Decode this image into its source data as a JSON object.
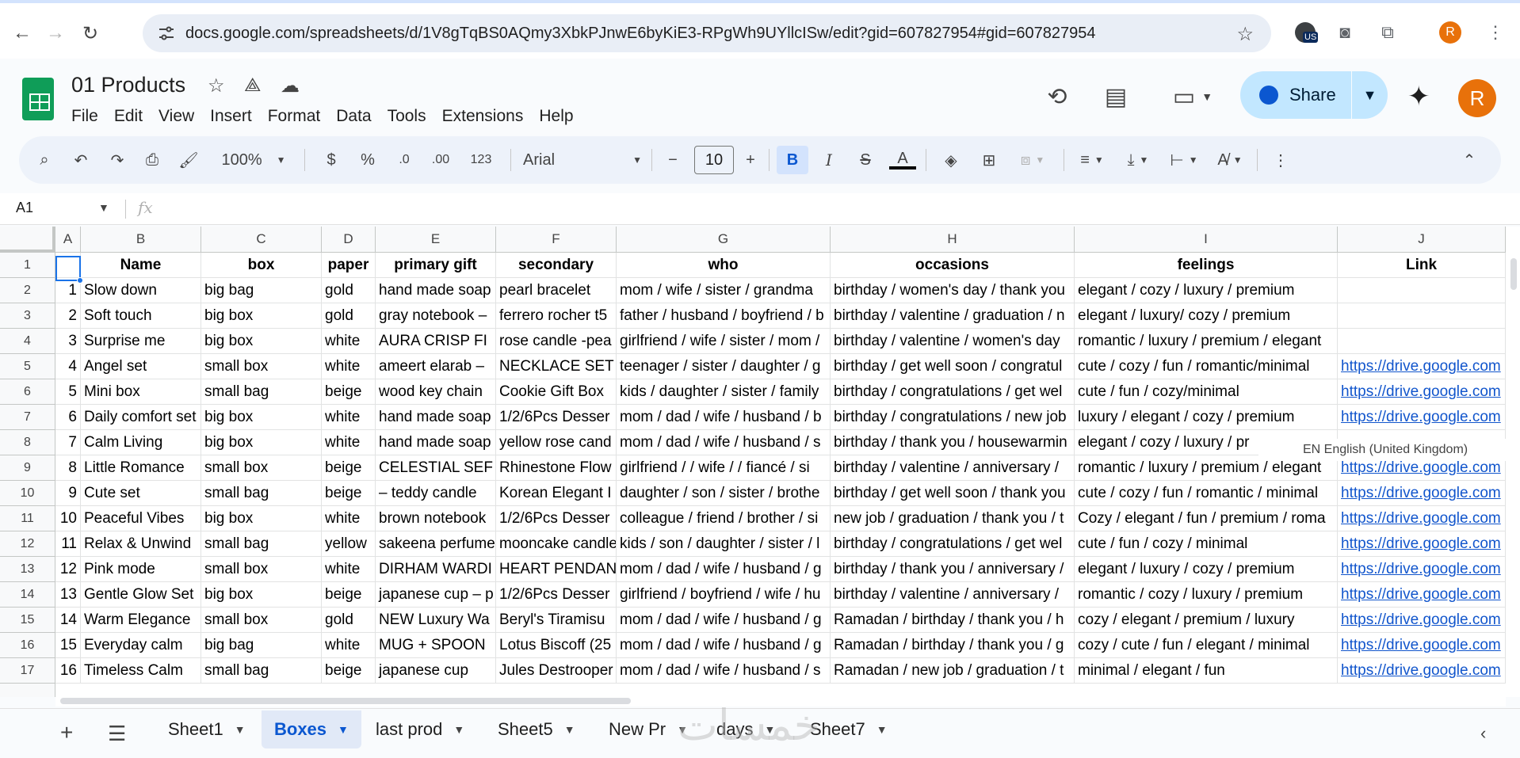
{
  "browser": {
    "url": "docs.google.com/spreadsheets/d/1V8gTqBS0AQmy3XbkPJnwE6byKiE3-RPgWh9UYllcISw/edit?gid=607827954#gid=607827954",
    "ext_badge": "US",
    "profile_initial": "R"
  },
  "doc": {
    "title": "01 Products",
    "menu": [
      "File",
      "Edit",
      "View",
      "Insert",
      "Format",
      "Data",
      "Tools",
      "Extensions",
      "Help"
    ],
    "share_label": "Share",
    "avatar_initial": "R"
  },
  "toolbar": {
    "zoom": "100%",
    "currency": "$",
    "percent": "%",
    "dec_decrease": ".0",
    "dec_increase": ".00",
    "number_format": "123",
    "font": "Arial",
    "font_size": "10",
    "minus": "−",
    "plus": "+",
    "bold": "B",
    "italic": "I",
    "strike": "S",
    "text_color": "A"
  },
  "formula": {
    "cell_ref": "A1",
    "fx": "fx"
  },
  "grid": {
    "columns": [
      "A",
      "B",
      "C",
      "D",
      "E",
      "F",
      "G",
      "H",
      "I",
      "J"
    ],
    "header_row": [
      "",
      "Name",
      "box",
      "paper",
      "primary gift",
      "secondary",
      "who",
      "occasions",
      "feelings",
      "Link"
    ],
    "rows": [
      {
        "n": "2",
        "cells": [
          "1",
          "Slow down",
          "big bag",
          "gold",
          "hand made soap",
          "pearl bracelet",
          "mom / wife / sister / grandma",
          "birthday / women's day / thank you",
          "elegant / cozy / luxury / premium",
          ""
        ]
      },
      {
        "n": "3",
        "cells": [
          "2",
          "Soft touch",
          "big box",
          "gold",
          "gray notebook –",
          "ferrero rocher t5",
          "father / husband / boyfriend / b",
          "birthday / valentine / graduation / n",
          "elegant / luxury/ cozy / premium",
          ""
        ]
      },
      {
        "n": "4",
        "cells": [
          "3",
          "Surprise me",
          "big box",
          "white",
          " AURA CRISP FI",
          "rose candle -pea",
          "girlfriend / wife / sister / mom /",
          "birthday / valentine / women's day",
          "romantic / luxury / premium / elegant",
          ""
        ]
      },
      {
        "n": "5",
        "cells": [
          "4",
          "Angel set",
          "small box",
          "white",
          "ameert elarab –",
          "NECKLACE SET",
          "teenager / sister / daughter / g",
          "birthday / get well soon / congratul",
          "cute / cozy / fun / romantic/minimal",
          "https://drive.google.com"
        ]
      },
      {
        "n": "6",
        "cells": [
          "5",
          "Mini box",
          "small bag",
          "beige",
          "wood key chain",
          " Cookie Gift Box",
          "kids / daughter / sister / family",
          "birthday / congratulations / get wel",
          "cute / fun / cozy/minimal",
          "https://drive.google.com"
        ]
      },
      {
        "n": "7",
        "cells": [
          "6",
          "Daily comfort set",
          "big box",
          "white",
          "hand made soap",
          "1/2/6Pcs Desser",
          "mom / dad / wife / husband / b",
          "birthday / congratulations / new job",
          "luxury / elegant / cozy / premium",
          "https://drive.google.com"
        ]
      },
      {
        "n": "8",
        "cells": [
          "7",
          "Calm Living",
          "big box",
          "white",
          "hand made soap",
          "yellow rose cand",
          "mom / dad / wife / husband / s",
          "birthday / thank you / housewarmin",
          "elegant / cozy / luxury / pr",
          ""
        ]
      },
      {
        "n": "9",
        "cells": [
          "8",
          "Little Romance",
          "small box",
          "beige",
          "CELESTIAL SEF",
          "Rhinestone Flow",
          "girlfriend /  / wife /  / fiancé / si",
          "birthday / valentine / anniversary /",
          "romantic / luxury / premium / elegant",
          "https://drive.google.com"
        ]
      },
      {
        "n": "10",
        "cells": [
          "9",
          "Cute set",
          "small bag",
          "beige",
          " – teddy candle",
          "Korean Elegant I",
          "daughter / son / sister / brothe",
          "birthday / get well soon / thank you",
          "cute / cozy / fun / romantic / minimal",
          "https://drive.google.com"
        ]
      },
      {
        "n": "11",
        "cells": [
          "10",
          "Peaceful Vibes",
          "big box",
          "white",
          "brown notebook",
          "1/2/6Pcs Desser",
          "colleague / friend / brother / si",
          "new job / graduation / thank you / t",
          "Cozy / elegant / fun / premium / roma",
          "https://drive.google.com"
        ]
      },
      {
        "n": "12",
        "cells": [
          "11",
          "Relax & Unwind",
          "small bag",
          "yellow",
          "sakeena perfume",
          "mooncake candle",
          "kids / son / daughter / sister / l",
          "birthday / congratulations / get wel",
          "cute / fun / cozy / minimal",
          "https://drive.google.com"
        ]
      },
      {
        "n": "13",
        "cells": [
          "12",
          "Pink mode",
          "small box",
          "white",
          "DIRHAM WARDI",
          "HEART PENDAN",
          "mom / dad / wife / husband / g",
          "birthday / thank you / anniversary /",
          "elegant / luxury / cozy / premium",
          "https://drive.google.com"
        ]
      },
      {
        "n": "14",
        "cells": [
          "13",
          "Gentle Glow Set",
          "big box",
          "beige",
          "japanese cup – p",
          "1/2/6Pcs Desser",
          "girlfriend / boyfriend / wife / hu",
          "birthday / valentine / anniversary /",
          "romantic / cozy / luxury / premium",
          "https://drive.google.com"
        ]
      },
      {
        "n": "15",
        "cells": [
          "14",
          "Warm Elegance",
          "small box",
          "gold",
          "NEW Luxury Wa",
          "Beryl's Tiramisu",
          "mom / dad / wife / husband / g",
          "Ramadan / birthday / thank you / h",
          "cozy / elegant / premium / luxury",
          "https://drive.google.com"
        ]
      },
      {
        "n": "16",
        "cells": [
          "15",
          "Everyday calm",
          "big bag",
          "white",
          "MUG + SPOON",
          "Lotus Biscoff (25",
          "mom / dad / wife / husband / g",
          "Ramadan / birthday / thank you / g",
          "cozy / cute / fun / elegant / minimal",
          "https://drive.google.com"
        ]
      },
      {
        "n": "17",
        "cells": [
          "16",
          "Timeless Calm",
          "small bag",
          "beige",
          "japanese cup",
          "Jules Destrooper",
          "mom / dad / wife / husband / s",
          "Ramadan / new job / graduation / t",
          "minimal / elegant / fun",
          "https://drive.google.com"
        ]
      }
    ],
    "language_tip": "EN English (United Kingdom)"
  },
  "tabs": {
    "items": [
      "Sheet1",
      "Boxes",
      "last prod",
      "Sheet5",
      "New Pr",
      "days",
      "Sheet7"
    ],
    "active_index": 1
  },
  "watermark": "خمسات",
  "colors": {
    "accent": "#0b57d0",
    "share_bg": "#c2e7ff",
    "sheets_green": "#0f9d58",
    "avatar": "#e8710a",
    "link": "#1155cc"
  }
}
